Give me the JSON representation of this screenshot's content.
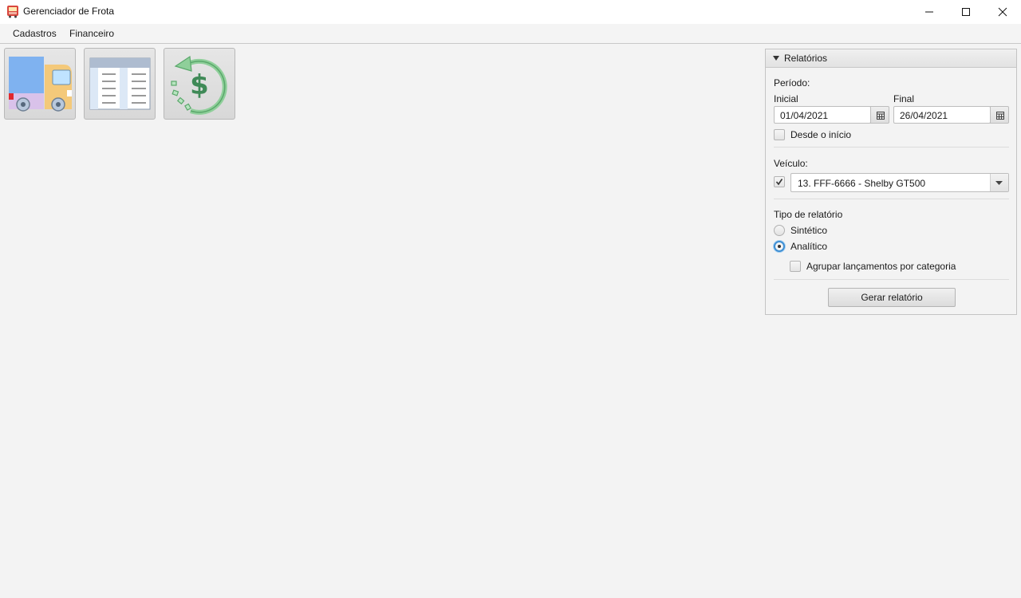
{
  "window": {
    "title": "Gerenciador de Frota",
    "controls": {
      "minimize": "minimize-icon",
      "maximize": "maximize-icon",
      "close": "close-icon"
    }
  },
  "menu": {
    "items": [
      {
        "label": "Cadastros"
      },
      {
        "label": "Financeiro"
      }
    ]
  },
  "toolbar": {
    "tiles": [
      {
        "icon": "truck-icon"
      },
      {
        "icon": "table-sheet-icon"
      },
      {
        "icon": "money-cycle-icon"
      }
    ]
  },
  "reports": {
    "title": "Relatórios",
    "period_label": "Período:",
    "initial_label": "Inicial",
    "initial_value": "01/04/2021",
    "final_label": "Final",
    "final_value": "26/04/2021",
    "since_start_label": "Desde o início",
    "since_start_checked": false,
    "vehicle_label": "Veículo:",
    "vehicle_enabled": true,
    "vehicle_value": "13. FFF-6666 - Shelby GT500",
    "report_type_label": "Tipo de relatório",
    "options": [
      {
        "label": "Sintético",
        "selected": false
      },
      {
        "label": "Analítico",
        "selected": true
      }
    ],
    "group_by_category_label": "Agrupar lançamentos por categoria",
    "group_by_category_checked": false,
    "generate_button": "Gerar relatório"
  },
  "colors": {
    "accent": "#3f8fd3",
    "truck_cargo": "#7fb2f0",
    "truck_cab": "#f4c97a",
    "money_green": "#5aa86b"
  }
}
